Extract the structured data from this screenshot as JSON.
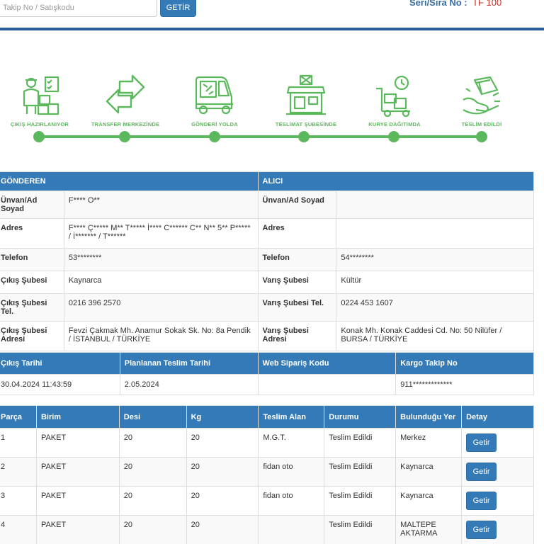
{
  "search": {
    "placeholder": "Takip No / Satışkodu",
    "button_label": "GETİR"
  },
  "seri": {
    "label": "Seri/Sıra No :",
    "value": "TF 100"
  },
  "steps": [
    {
      "label": "ÇIKIŞ HAZIRLANIYOR",
      "icon": "worker-boxes-icon"
    },
    {
      "label": "TRANSFER MERKEZİNDE",
      "icon": "transfer-arrows-icon"
    },
    {
      "label": "GÖNDERİ YOLDA",
      "icon": "delivery-truck-icon"
    },
    {
      "label": "TESLİMAT ŞUBESİNDE",
      "icon": "branch-store-icon"
    },
    {
      "label": "KURYE DAĞITIMDA",
      "icon": "hand-truck-icon"
    },
    {
      "label": "TESLİM EDİLDİ",
      "icon": "delivered-package-icon"
    }
  ],
  "colors": {
    "primary": "#337ab7",
    "step_green": "#5cb85c",
    "top_rule": "#2a5e9a"
  },
  "sender": {
    "header": "GÖNDEREN",
    "rows": [
      {
        "label": "Ünvan/Ad Soyad",
        "value": "F**** O**"
      },
      {
        "label": "Adres",
        "value": "F**** Ç***** M** T***** İ**** C****** C** N** 5** P***** / İ******* / T******"
      },
      {
        "label": "Telefon",
        "value": "53********"
      },
      {
        "label": "Çıkış Şubesi",
        "value": "Kaynarca"
      },
      {
        "label": "Çıkış Şubesi Tel.",
        "value": "0216 396 2570"
      },
      {
        "label": "Çıkış Şubesi Adresi",
        "value": "Fevzi Çakmak Mh. Anamur Sokak Sk. No: 8a Pendik / İSTANBUL / TÜRKİYE"
      }
    ]
  },
  "receiver": {
    "header": "ALICI",
    "rows": [
      {
        "label": "Ünvan/Ad Soyad",
        "value": ""
      },
      {
        "label": "Adres",
        "value": ""
      },
      {
        "label": "Telefon",
        "value": "54********"
      },
      {
        "label": "Varış Şubesi",
        "value": "Kültür"
      },
      {
        "label": "Varış Şubesi Tel.",
        "value": "0224 453 1607"
      },
      {
        "label": "Varış Şubesi Adresi",
        "value": "Konak Mh. Konak Caddesi Cd. No: 50 Nilüfer / BURSA / TÜRKİYE"
      }
    ]
  },
  "shipment": {
    "headers": [
      "Çıkış Tarihi",
      "Planlanan Teslim Tarihi",
      "Web Sipariş Kodu",
      "Kargo Takip No"
    ],
    "values": [
      "30.04.2024 11:43:59",
      "2.05.2024",
      "",
      "911*************"
    ]
  },
  "pieces": {
    "headers": [
      "Parça",
      "Birim",
      "Desi",
      "Kg",
      "Teslim Alan",
      "Durumu",
      "Bulunduğu Yer",
      "Detay"
    ],
    "button_label": "Getir",
    "rows": [
      [
        "1",
        "PAKET",
        "20",
        "20",
        "M.G.T.",
        "Teslim Edildi",
        "Merkez"
      ],
      [
        "2",
        "PAKET",
        "20",
        "20",
        "fidan oto",
        "Teslim Edildi",
        "Kaynarca"
      ],
      [
        "3",
        "PAKET",
        "20",
        "20",
        "fidan oto",
        "Teslim Edildi",
        "Kaynarca"
      ],
      [
        "4",
        "PAKET",
        "20",
        "20",
        "",
        "Teslim Edildi",
        "MALTEPE AKTARMA"
      ]
    ]
  }
}
